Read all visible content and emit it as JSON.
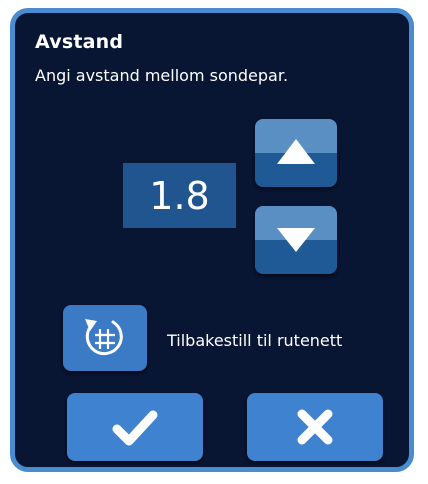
{
  "dialog": {
    "title": "Avstand",
    "subtitle": "Angi avstand mellom sondepar."
  },
  "spacing": {
    "value": "1.8",
    "increase_icon": "triangle-up-icon",
    "decrease_icon": "triangle-down-icon"
  },
  "reset": {
    "icon": "grid-reset-icon",
    "label": "Tilbakestill til rutenett"
  },
  "actions": {
    "confirm_icon": "checkmark-icon",
    "cancel_icon": "close-icon"
  },
  "colors": {
    "background": "#081533",
    "border": "#4a8cd0",
    "value_box": "#21558f",
    "button": "#3f82cf"
  }
}
